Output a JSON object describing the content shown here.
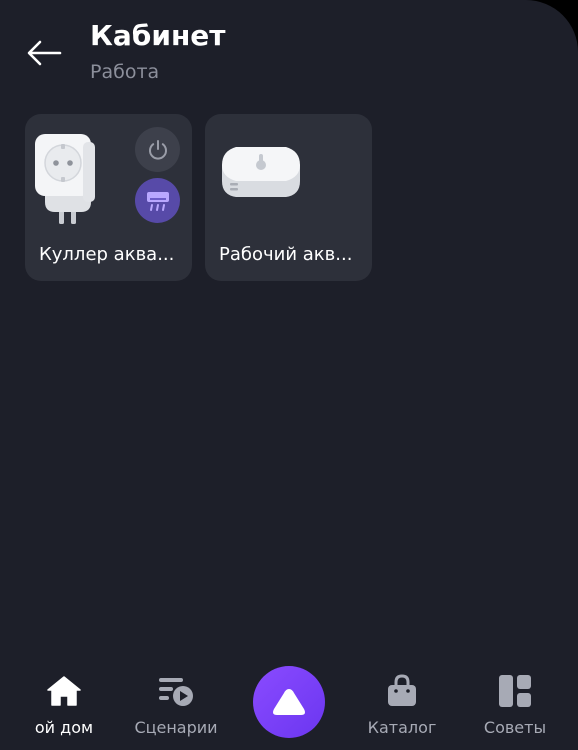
{
  "header": {
    "title": "Кабинет",
    "subtitle": "Работа",
    "back_icon": "arrow-left-icon"
  },
  "devices": [
    {
      "name": "Куллер аква...",
      "image": "smart-plug-icon",
      "controls": [
        "power-icon",
        "air-conditioner-icon"
      ]
    },
    {
      "name": "Рабочий акв...",
      "image": "temperature-sensor-icon"
    }
  ],
  "bottom_nav": {
    "items": [
      {
        "label": "ой дом",
        "icon": "home-icon",
        "active": true
      },
      {
        "label": "Сценарии",
        "icon": "scenarios-icon",
        "active": false
      },
      {
        "label": "Каталог",
        "icon": "shopping-bag-icon",
        "active": false
      },
      {
        "label": "Советы",
        "icon": "tips-grid-icon",
        "active": false
      }
    ],
    "assistant_icon": "alice-icon"
  },
  "colors": {
    "background": "#1d1f29",
    "card": "#2d303a",
    "accent": "#6b36f0",
    "mode_button": "#574aa8",
    "muted_text": "#8c8f9b"
  }
}
